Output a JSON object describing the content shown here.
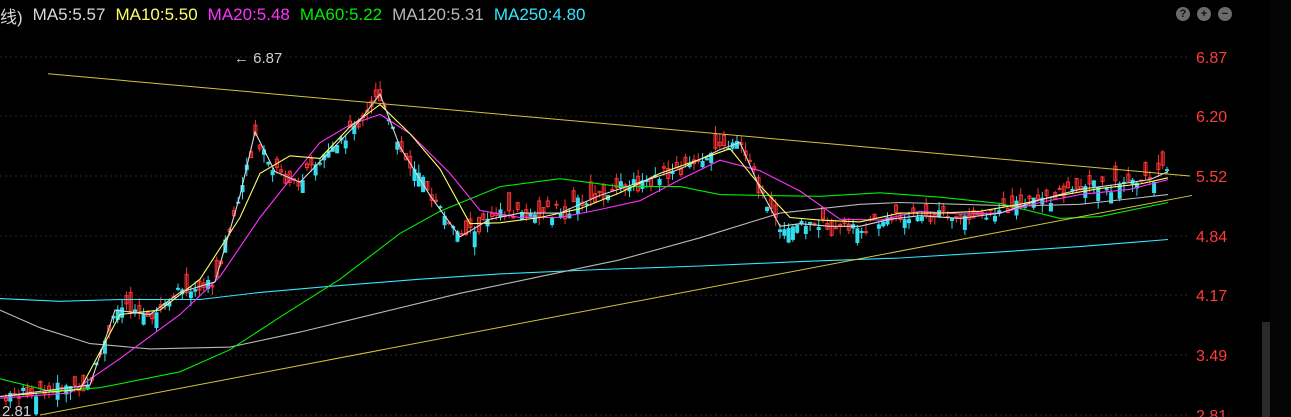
{
  "header": {
    "prefix": "线)",
    "ma": [
      {
        "label": "MA5:5.57",
        "color": "#d9d9d9"
      },
      {
        "label": "MA10:5.50",
        "color": "#ffff66"
      },
      {
        "label": "MA20:5.48",
        "color": "#ff33ff"
      },
      {
        "label": "MA60:5.22",
        "color": "#00ee00"
      },
      {
        "label": "MA120:5.31",
        "color": "#b8b8b8"
      },
      {
        "label": "MA250:4.80",
        "color": "#33e6ff"
      }
    ],
    "icons": [
      "help-icon",
      "zoom-in-icon",
      "zoom-out-icon"
    ]
  },
  "chart_data": {
    "type": "candlestick",
    "y_ticks": [
      "6.87",
      "6.20",
      "5.52",
      "4.84",
      "4.17",
      "3.49",
      "2.81"
    ],
    "ylim": [
      2.81,
      6.87
    ],
    "annotations": [
      {
        "text": "6.87",
        "kind": "high-marker"
      },
      {
        "text": "2.81",
        "kind": "low-marker"
      }
    ],
    "ma_series": [
      {
        "name": "MA250",
        "color": "#33e6ff",
        "points": [
          [
            0,
            4.13
          ],
          [
            60,
            4.1
          ],
          [
            120,
            4.12
          ],
          [
            200,
            4.12
          ],
          [
            260,
            4.2
          ],
          [
            330,
            4.27
          ],
          [
            420,
            4.35
          ],
          [
            500,
            4.41
          ],
          [
            600,
            4.46
          ],
          [
            700,
            4.5
          ],
          [
            800,
            4.55
          ],
          [
            900,
            4.59
          ],
          [
            1000,
            4.66
          ],
          [
            1080,
            4.72
          ],
          [
            1168,
            4.8
          ]
        ]
      },
      {
        "name": "MA120",
        "color": "#b8b8b8",
        "points": [
          [
            0,
            4.0
          ],
          [
            40,
            3.8
          ],
          [
            90,
            3.62
          ],
          [
            150,
            3.56
          ],
          [
            230,
            3.58
          ],
          [
            300,
            3.75
          ],
          [
            380,
            3.97
          ],
          [
            460,
            4.19
          ],
          [
            540,
            4.38
          ],
          [
            620,
            4.57
          ],
          [
            700,
            4.82
          ],
          [
            780,
            5.1
          ],
          [
            860,
            5.2
          ],
          [
            900,
            5.22
          ],
          [
            960,
            5.2
          ],
          [
            1020,
            5.18
          ],
          [
            1080,
            5.2
          ],
          [
            1168,
            5.31
          ]
        ]
      },
      {
        "name": "MA60",
        "color": "#00ee00",
        "points": [
          [
            0,
            3.22
          ],
          [
            50,
            3.08
          ],
          [
            100,
            3.12
          ],
          [
            180,
            3.3
          ],
          [
            230,
            3.55
          ],
          [
            280,
            3.92
          ],
          [
            340,
            4.35
          ],
          [
            400,
            4.87
          ],
          [
            440,
            5.12
          ],
          [
            500,
            5.4
          ],
          [
            560,
            5.49
          ],
          [
            620,
            5.4
          ],
          [
            680,
            5.4
          ],
          [
            720,
            5.31
          ],
          [
            760,
            5.3
          ],
          [
            820,
            5.29
          ],
          [
            880,
            5.33
          ],
          [
            940,
            5.28
          ],
          [
            1000,
            5.21
          ],
          [
            1060,
            5.04
          ],
          [
            1100,
            5.06
          ],
          [
            1168,
            5.22
          ]
        ]
      },
      {
        "name": "MA20",
        "color": "#ff33ff",
        "points": [
          [
            0,
            3.0
          ],
          [
            70,
            3.06
          ],
          [
            120,
            3.45
          ],
          [
            180,
            3.95
          ],
          [
            220,
            4.38
          ],
          [
            260,
            5.05
          ],
          [
            290,
            5.48
          ],
          [
            320,
            5.9
          ],
          [
            350,
            6.1
          ],
          [
            380,
            6.22
          ],
          [
            410,
            6.0
          ],
          [
            450,
            5.55
          ],
          [
            480,
            5.13
          ],
          [
            520,
            5.05
          ],
          [
            560,
            5.05
          ],
          [
            600,
            5.14
          ],
          [
            640,
            5.24
          ],
          [
            680,
            5.48
          ],
          [
            720,
            5.7
          ],
          [
            760,
            5.58
          ],
          [
            800,
            5.35
          ],
          [
            840,
            5.03
          ],
          [
            880,
            5.02
          ],
          [
            920,
            5.12
          ],
          [
            960,
            5.09
          ],
          [
            1000,
            5.1
          ],
          [
            1040,
            5.22
          ],
          [
            1080,
            5.31
          ],
          [
            1130,
            5.37
          ],
          [
            1168,
            5.48
          ]
        ]
      },
      {
        "name": "MA10",
        "color": "#ffff66",
        "points": [
          [
            0,
            3.02
          ],
          [
            80,
            3.1
          ],
          [
            120,
            3.95
          ],
          [
            160,
            4.0
          ],
          [
            200,
            4.35
          ],
          [
            240,
            5.05
          ],
          [
            260,
            5.55
          ],
          [
            290,
            5.75
          ],
          [
            320,
            5.72
          ],
          [
            350,
            6.08
          ],
          [
            380,
            6.33
          ],
          [
            410,
            6.0
          ],
          [
            440,
            5.6
          ],
          [
            470,
            4.98
          ],
          [
            500,
            4.99
          ],
          [
            540,
            5.05
          ],
          [
            580,
            5.15
          ],
          [
            620,
            5.33
          ],
          [
            660,
            5.55
          ],
          [
            700,
            5.71
          ],
          [
            730,
            5.83
          ],
          [
            760,
            5.41
          ],
          [
            790,
            5.05
          ],
          [
            820,
            5.02
          ],
          [
            860,
            5.0
          ],
          [
            900,
            5.1
          ],
          [
            940,
            5.1
          ],
          [
            980,
            5.12
          ],
          [
            1020,
            5.2
          ],
          [
            1060,
            5.3
          ],
          [
            1100,
            5.38
          ],
          [
            1140,
            5.43
          ],
          [
            1168,
            5.5
          ]
        ]
      },
      {
        "name": "MA5",
        "color": "#d9d9d9",
        "points": [
          [
            0,
            3.02
          ],
          [
            90,
            3.15
          ],
          [
            115,
            4.0
          ],
          [
            150,
            3.95
          ],
          [
            180,
            4.2
          ],
          [
            215,
            4.32
          ],
          [
            240,
            5.3
          ],
          [
            255,
            6.02
          ],
          [
            275,
            5.57
          ],
          [
            300,
            5.45
          ],
          [
            330,
            5.8
          ],
          [
            360,
            6.15
          ],
          [
            380,
            6.45
          ],
          [
            400,
            5.85
          ],
          [
            430,
            5.3
          ],
          [
            460,
            4.83
          ],
          [
            490,
            5.03
          ],
          [
            520,
            5.1
          ],
          [
            560,
            5.1
          ],
          [
            600,
            5.3
          ],
          [
            640,
            5.45
          ],
          [
            680,
            5.6
          ],
          [
            720,
            5.82
          ],
          [
            740,
            5.9
          ],
          [
            760,
            5.38
          ],
          [
            780,
            4.95
          ],
          [
            800,
            4.98
          ],
          [
            830,
            4.95
          ],
          [
            860,
            4.95
          ],
          [
            890,
            5.03
          ],
          [
            920,
            5.07
          ],
          [
            960,
            5.04
          ],
          [
            1000,
            5.1
          ],
          [
            1040,
            5.25
          ],
          [
            1080,
            5.37
          ],
          [
            1120,
            5.43
          ],
          [
            1150,
            5.48
          ],
          [
            1168,
            5.57
          ]
        ]
      }
    ],
    "trendlines": [
      {
        "name": "upper",
        "color": "#d4c53a",
        "points": [
          [
            48,
            6.68
          ],
          [
            1190,
            5.52
          ]
        ]
      },
      {
        "name": "lower",
        "color": "#d4c53a",
        "points": [
          [
            40,
            2.81
          ],
          [
            1192,
            5.3
          ]
        ]
      }
    ]
  }
}
